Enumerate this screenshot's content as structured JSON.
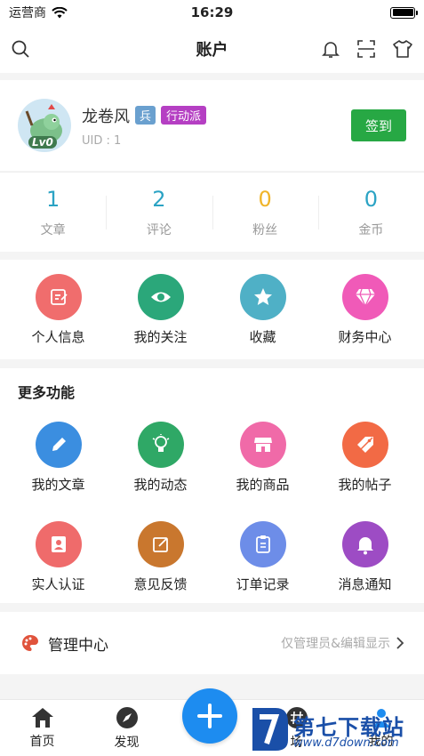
{
  "status_bar": {
    "carrier": "运营商",
    "time": "16:29",
    "battery_level": 1.0
  },
  "nav": {
    "title": "账户",
    "left_icon": "search-icon",
    "right_icons": [
      "bell-icon",
      "scan-icon",
      "shirt-icon"
    ]
  },
  "profile": {
    "name": "龙卷风",
    "tag_rank": "兵",
    "tag_group": "行动派",
    "uid": "UID : 1",
    "level": "Lv0",
    "checkin_label": "签到"
  },
  "stats": [
    {
      "value": "1",
      "label": "文章",
      "color": "#2ba3c4"
    },
    {
      "value": "2",
      "label": "评论",
      "color": "#2ba3c4"
    },
    {
      "value": "0",
      "label": "粉丝",
      "color": "#f0b429"
    },
    {
      "value": "0",
      "label": "金币",
      "color": "#2ba3c4"
    }
  ],
  "quick_menu": [
    {
      "label": "个人信息",
      "icon": "edit-icon",
      "color": "#f06d6d"
    },
    {
      "label": "我的关注",
      "icon": "eye-icon",
      "color": "#2ba77a"
    },
    {
      "label": "收藏",
      "icon": "star-icon",
      "color": "#4fb0c6"
    },
    {
      "label": "财务中心",
      "icon": "diamond-icon",
      "color": "#f05ab8"
    }
  ],
  "more_functions": {
    "heading": "更多功能",
    "items": [
      {
        "label": "我的文章",
        "icon": "pen-icon",
        "color": "#3b8ee0"
      },
      {
        "label": "我的动态",
        "icon": "bulb-icon",
        "color": "#2fa866"
      },
      {
        "label": "我的商品",
        "icon": "store-icon",
        "color": "#f06aa8"
      },
      {
        "label": "我的帖子",
        "icon": "tag-icon",
        "color": "#f26a45"
      },
      {
        "label": "实人认证",
        "icon": "id-card-icon",
        "color": "#ef6b6b"
      },
      {
        "label": "意见反馈",
        "icon": "feedback-icon",
        "color": "#c9772e"
      },
      {
        "label": "订单记录",
        "icon": "clipboard-icon",
        "color": "#6d8de8"
      },
      {
        "label": "消息通知",
        "icon": "bell-icon",
        "color": "#9d4cc4"
      }
    ]
  },
  "admin": {
    "label": "管理中心",
    "hint": "仅管理员&编辑显示",
    "icon": "palette-icon",
    "color": "#e0533c"
  },
  "tabs": [
    {
      "label": "首页",
      "icon": "home-icon"
    },
    {
      "label": "发现",
      "icon": "compass-icon"
    },
    {
      "label": "场",
      "icon": "hash-icon"
    },
    {
      "label": "我的",
      "icon": "user-icon"
    }
  ],
  "fab": {
    "icon": "plus-icon",
    "color": "#1d8cf0"
  },
  "watermark": {
    "text": "第七下载站",
    "url": "www.d7down.com"
  }
}
